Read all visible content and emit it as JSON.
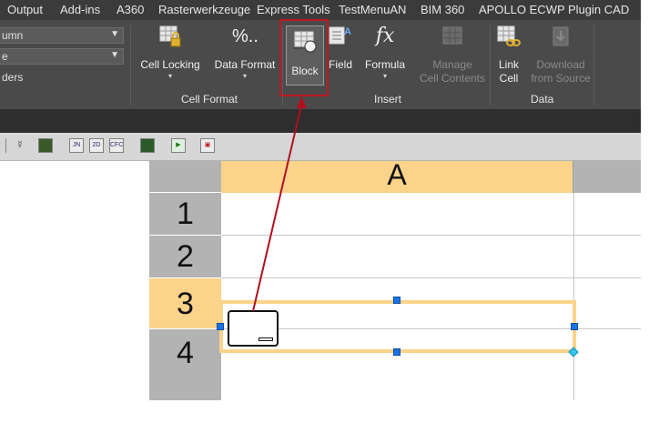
{
  "menu": [
    "Output",
    "Add-ins",
    "A360",
    "Rasterwerkzeuge",
    "Express Tools",
    "TestMenuAN",
    "BIM 360",
    "APOLLO ECWP Plugin CAD"
  ],
  "ribbon": {
    "left": {
      "combo1": "umn",
      "combo2": "e",
      "text3": "ders"
    },
    "cell_format": {
      "label": "Cell Format",
      "cell_locking": "Cell Locking",
      "data_format": "Data Format",
      "data_format_icon": "%.."
    },
    "insert": {
      "label": "Insert",
      "block": "Block",
      "field": "Field",
      "formula": "Formula",
      "formula_icon": "fx",
      "manage_line1": "Manage",
      "manage_line2": "Cell Contents"
    },
    "data": {
      "label": "Data",
      "link_line1": "Link",
      "link_line2": "Cell",
      "download_line1": "Download",
      "download_line2": "from Source"
    }
  },
  "toolbar_icons": [
    "JN",
    "2D",
    "CFC"
  ],
  "sheet": {
    "column_a": "A",
    "rows": [
      "1",
      "2",
      "3",
      "4"
    ]
  },
  "colors": {
    "highlight": "#c01820",
    "selection": "#fbd38a",
    "grip": "#1a73e8"
  }
}
